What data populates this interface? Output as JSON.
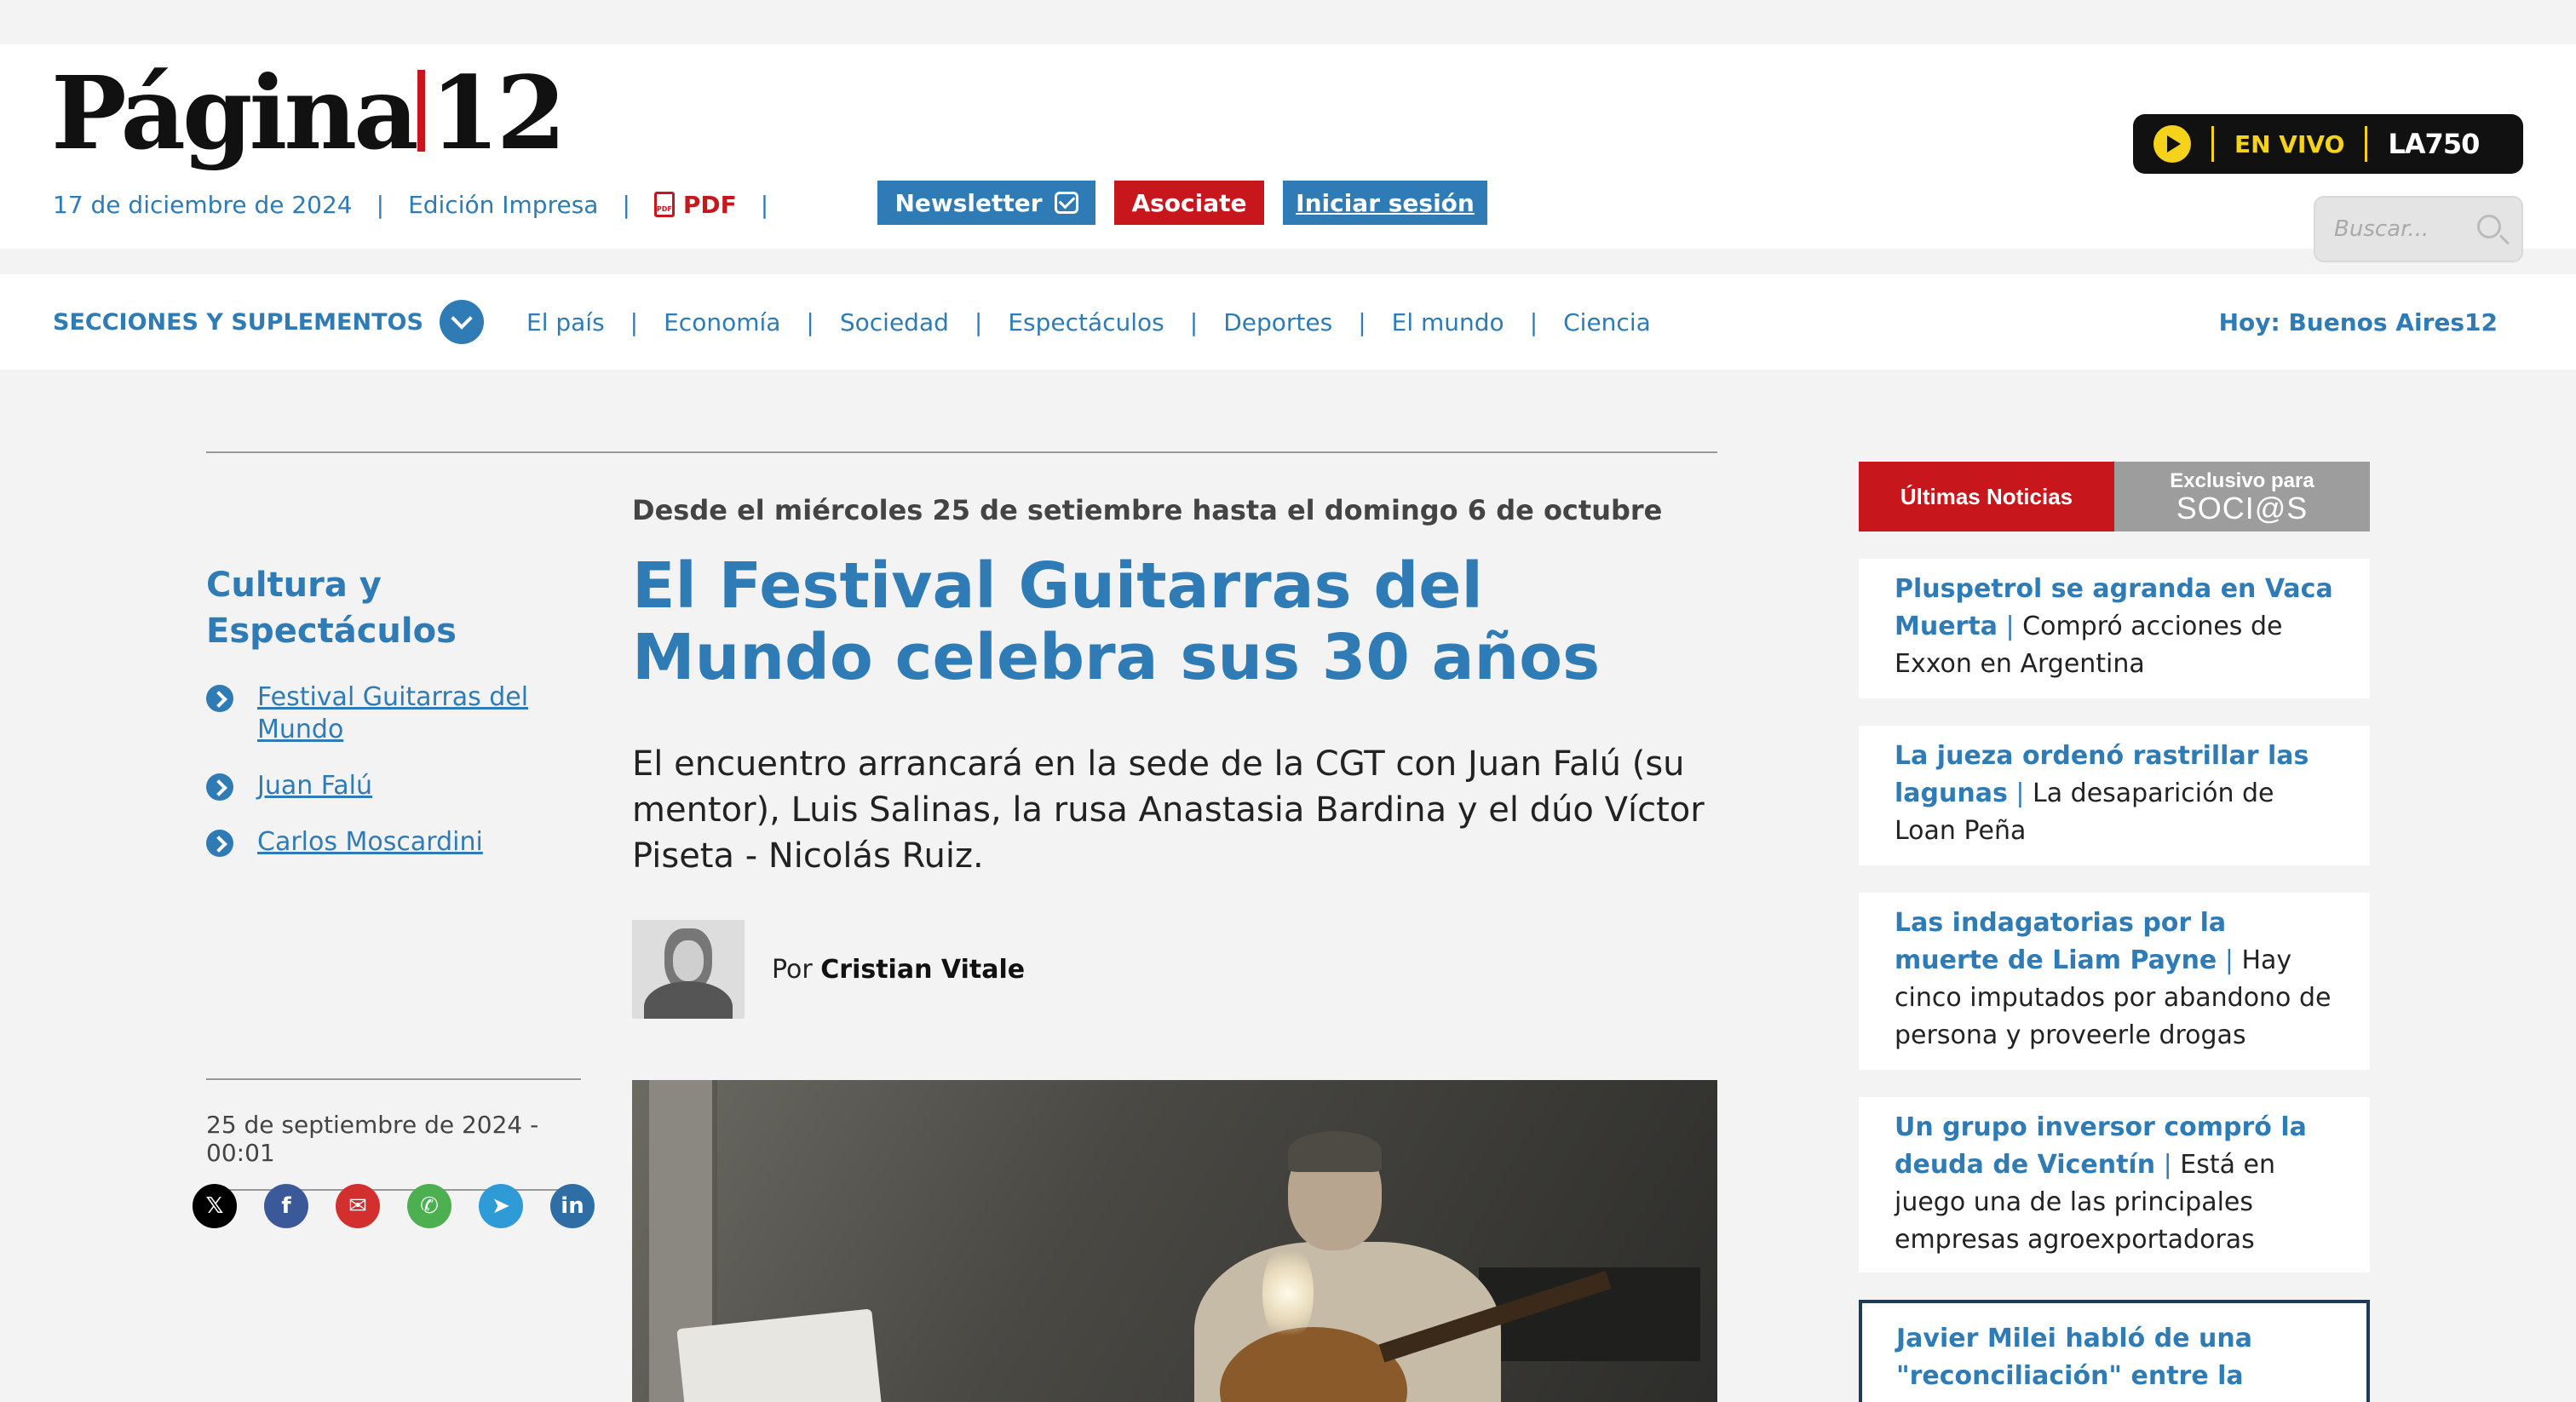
{
  "brand": {
    "logo_left": "Página",
    "logo_right": "12",
    "accent": "#2f7bb5",
    "red": "#c8161d"
  },
  "topbar": {
    "date": "17 de diciembre de 2024",
    "edition": "Edición Impresa",
    "pdf_label": "PDF",
    "pdf_icon_text": "PDF",
    "separator": "|"
  },
  "buttons": {
    "newsletter": "Newsletter",
    "asociate": "Asociate",
    "login": "Iniciar sesión"
  },
  "radio": {
    "live": "EN VIVO",
    "station": "LA750"
  },
  "search": {
    "placeholder": "Buscar..."
  },
  "nav": {
    "sections_label": "SECCIONES Y SUPLEMENTOS",
    "links": [
      "El país",
      "Economía",
      "Sociedad",
      "Espectáculos",
      "Deportes",
      "El mundo",
      "Ciencia"
    ],
    "today": "Hoy: Buenos Aires12"
  },
  "sidebar": {
    "category": "Cultura y Espectáculos",
    "tags": [
      "Festival Guitarras del Mundo",
      "Juan Falú",
      "Carlos Moscardini"
    ],
    "published": "25 de septiembre de 2024 - 00:01",
    "share": [
      {
        "icon": "x-icon",
        "glyph": "𝕏"
      },
      {
        "icon": "facebook-icon",
        "glyph": "f"
      },
      {
        "icon": "email-icon",
        "glyph": "✉"
      },
      {
        "icon": "whatsapp-icon",
        "glyph": "✆"
      },
      {
        "icon": "telegram-icon",
        "glyph": "➤"
      },
      {
        "icon": "linkedin-icon",
        "glyph": "in"
      }
    ]
  },
  "article": {
    "kicker": "Desde el miércoles 25 de setiembre hasta el domingo 6 de octubre",
    "headline": "El Festival Guitarras del Mundo celebra sus 30 años",
    "lead": "El encuentro arrancará en la sede de la CGT con Juan Falú (su mentor), Luis Salinas, la rusa Anastasia Bardina y el dúo Víctor Piseta - Nicolás Ruiz.",
    "by": "Por",
    "author": "Cristian Vitale"
  },
  "right": {
    "tab_latest": "Últimas Noticias",
    "tab_exclusive_1": "Exclusivo para",
    "tab_exclusive_2": "SOCI@S",
    "news": [
      {
        "head": "Pluspetrol se agranda en Vaca Muerta",
        "body": "Compró acciones de Exxon en Argentina"
      },
      {
        "head": "La jueza ordenó rastrillar las lagunas",
        "body": "La desaparición de Loan Peña"
      },
      {
        "head": "Las indagatorias por la muerte de Liam Payne",
        "body": "Hay cinco imputados por abandono de persona y proveerle drogas"
      },
      {
        "head": "Un grupo inversor compró la deuda de Vicentín",
        "body": "Está en juego una de las principales empresas agroexportadoras"
      },
      {
        "head": "Javier Milei habló de una \"reconciliación\" entre la",
        "body": ""
      }
    ]
  }
}
